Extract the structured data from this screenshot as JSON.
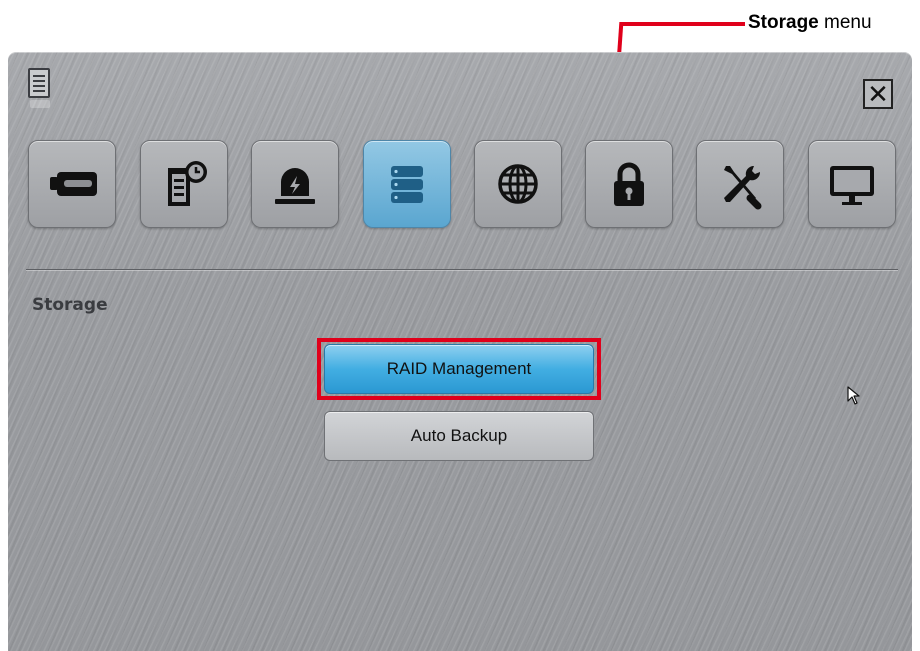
{
  "callout": {
    "bold": "Storage",
    "rest": " menu"
  },
  "window": {
    "close_label": "✕"
  },
  "toolbar": {
    "items": [
      {
        "icon": "hdd-icon",
        "active": false
      },
      {
        "icon": "schedule-icon",
        "active": false
      },
      {
        "icon": "alarm-icon",
        "active": false
      },
      {
        "icon": "storage-icon",
        "active": true
      },
      {
        "icon": "network-icon",
        "active": false
      },
      {
        "icon": "lock-icon",
        "active": false
      },
      {
        "icon": "tools-icon",
        "active": false
      },
      {
        "icon": "monitor-icon",
        "active": false
      }
    ]
  },
  "section": {
    "title": "Storage"
  },
  "buttons": {
    "raid": "RAID Management",
    "backup": "Auto Backup"
  },
  "colors": {
    "highlight": "#e0001b",
    "active_tab": "#5aa6d0",
    "panel": "#9b9da1"
  }
}
